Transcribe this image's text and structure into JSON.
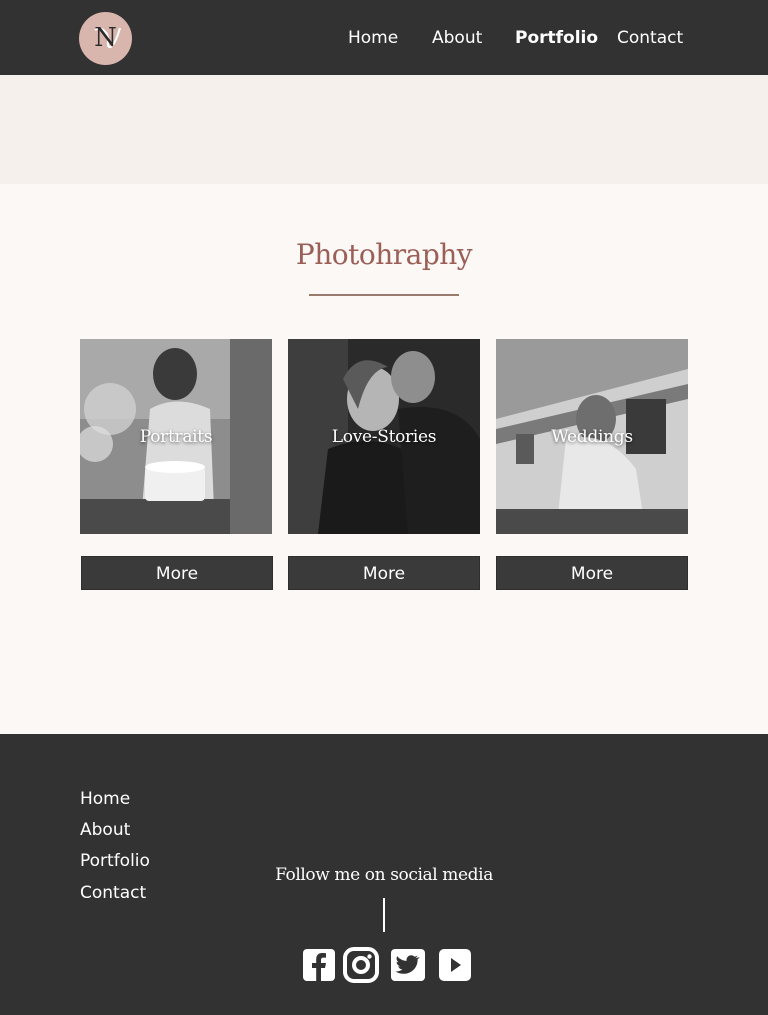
{
  "header": {
    "logo_letter": "N",
    "nav": [
      {
        "label": "Home"
      },
      {
        "label": "About"
      },
      {
        "label": "Portfolio",
        "active": true
      },
      {
        "label": "Contact"
      }
    ]
  },
  "section": {
    "title": "Photohraphy",
    "cards": [
      {
        "label": "Portraits",
        "button": "More"
      },
      {
        "label": "Love-Stories",
        "button": "More"
      },
      {
        "label": "Weddings",
        "button": "More"
      }
    ]
  },
  "footer": {
    "links": [
      "Home",
      "About",
      "Portfolio",
      "Contact"
    ],
    "follow_text": "Follow me on social media",
    "social_icons": [
      "facebook-icon",
      "instagram-icon",
      "twitter-icon",
      "youtube-icon"
    ]
  },
  "colors": {
    "header_bg": "#323232",
    "accent": "#9b5f57",
    "logo_bg": "#d8b5ad",
    "page_bg": "#fbf8f6"
  }
}
